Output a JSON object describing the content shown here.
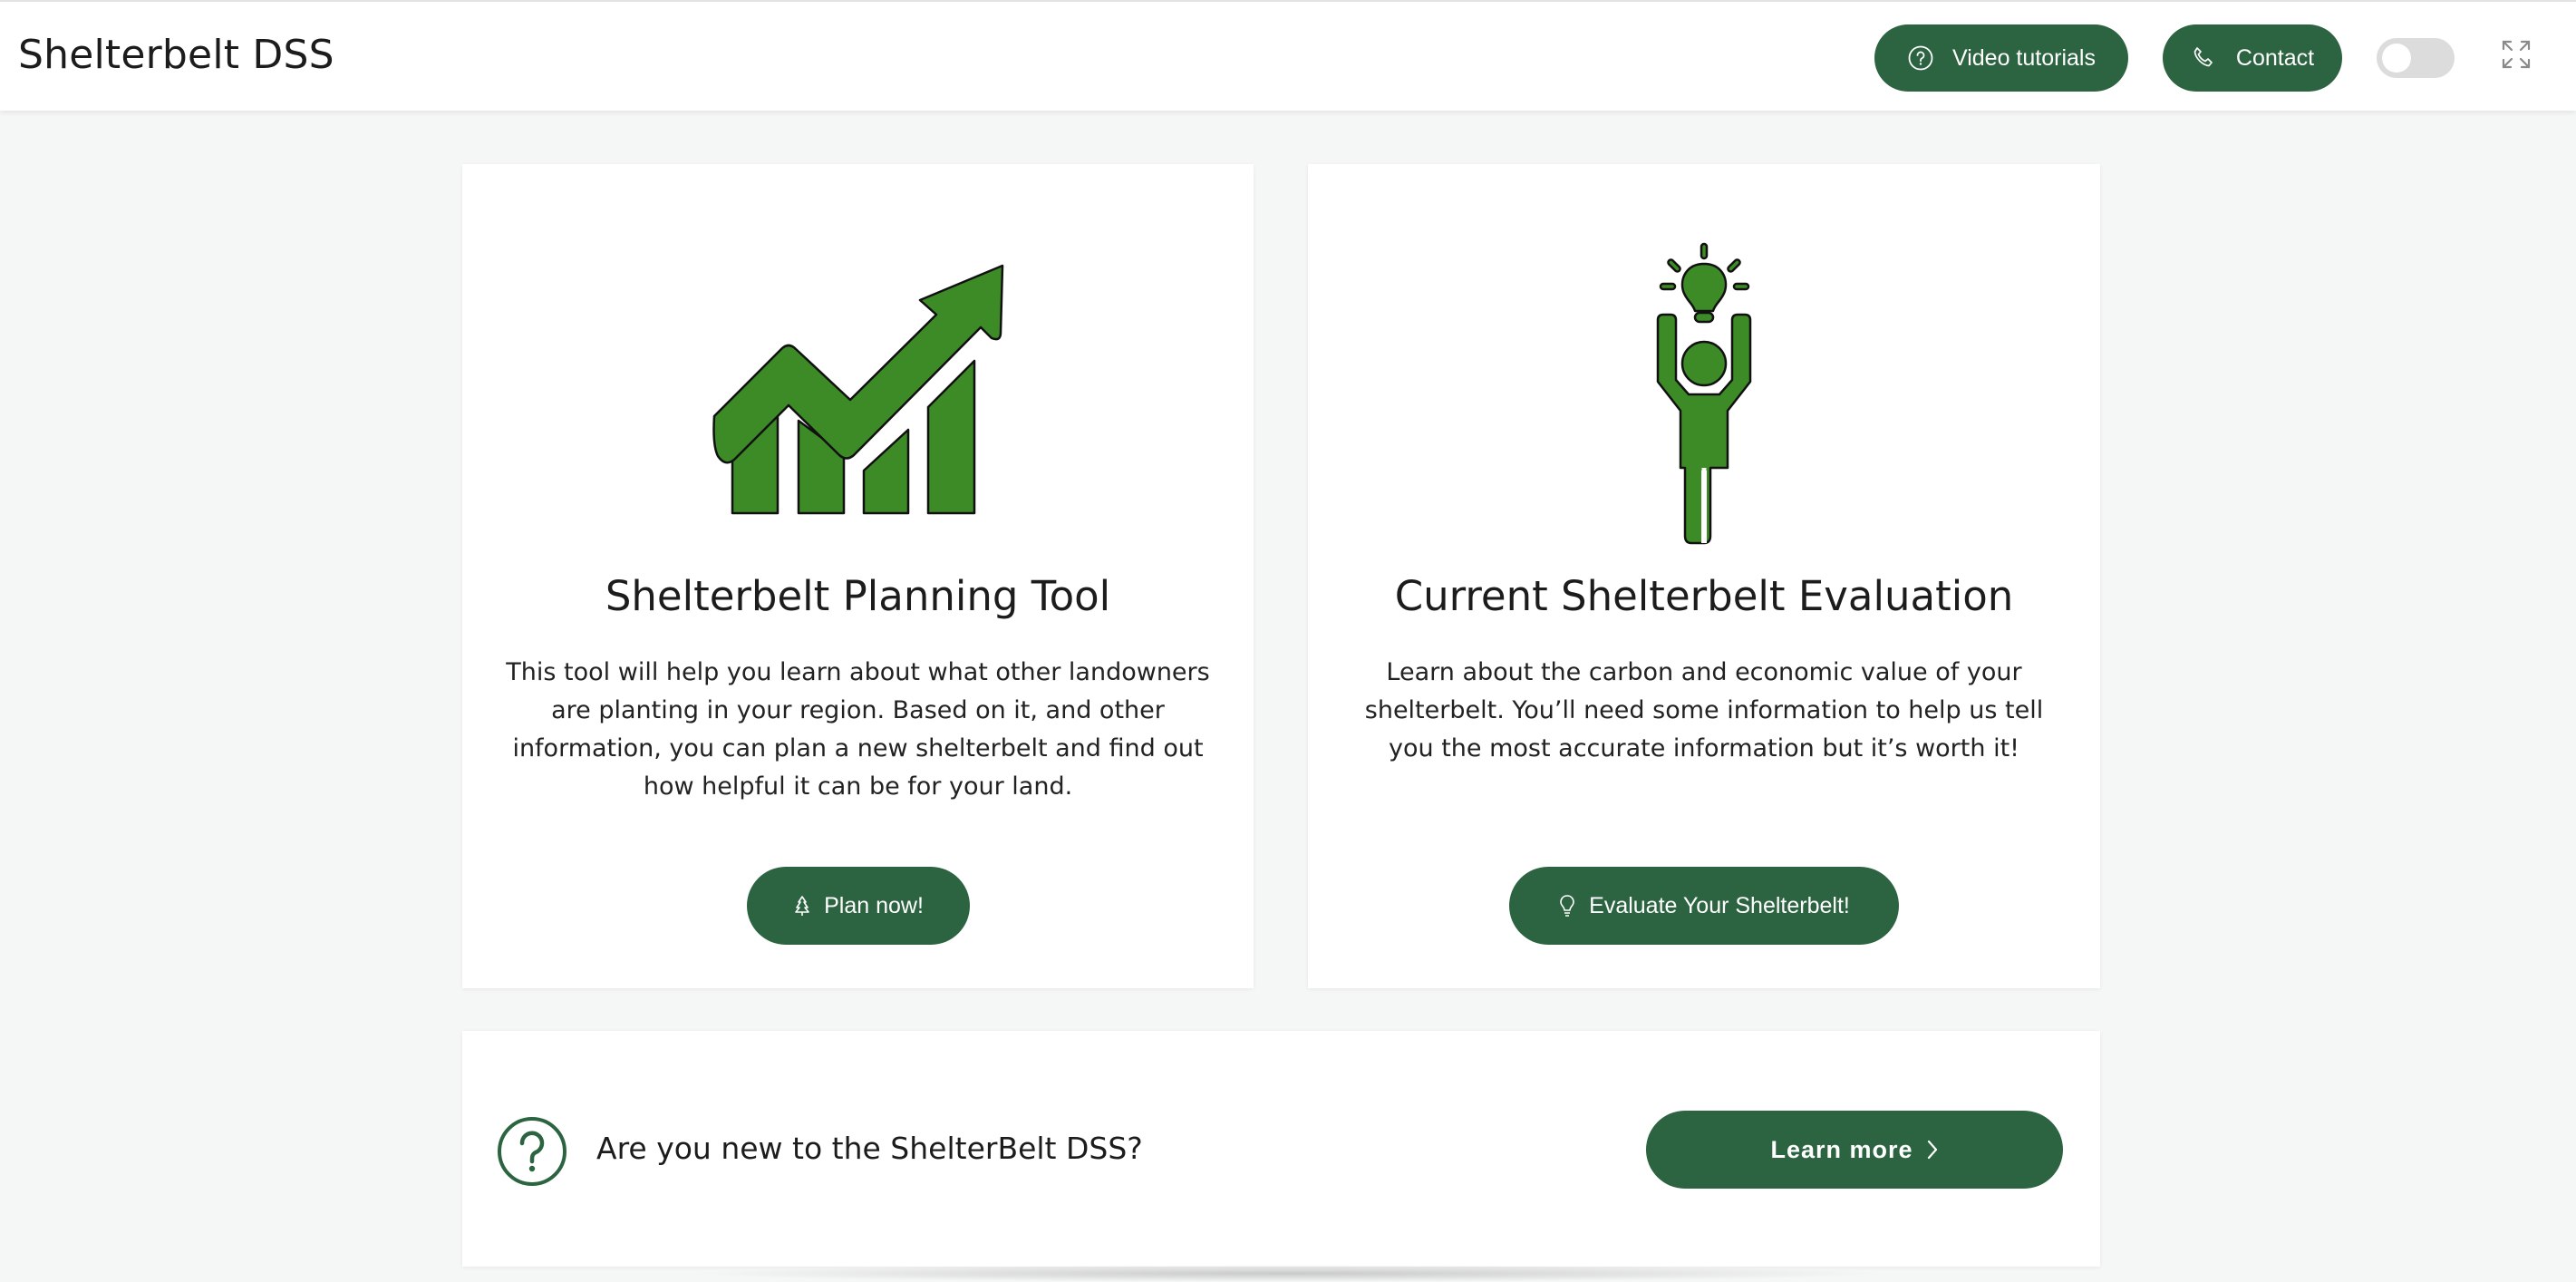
{
  "header": {
    "title": "Shelterbelt DSS",
    "video_label": "Video tutorials",
    "contact_label": "Contact",
    "toggle_state": "off"
  },
  "cards": [
    {
      "title": "Shelterbelt Planning Tool",
      "description": "This tool will help you learn about what other landowners are planting in your region. Based on it, and other information, you can plan a new shelterbelt and find out how helpful it can be for your land.",
      "button_label": "Plan now!",
      "button_icon": "tree-icon",
      "illustration": "growth-chart-icon"
    },
    {
      "title": "Current Shelterbelt Evaluation",
      "description": "Learn about the carbon and economic value of your shelterbelt. You’ll need some information to help us tell you the most accurate information but it’s worth it!",
      "button_label": "Evaluate Your Shelterbelt!",
      "button_icon": "lightbulb-icon",
      "illustration": "person-idea-icon"
    }
  ],
  "banner": {
    "question": "Are you new to the ShelterBelt DSS?",
    "button_label": "Learn more",
    "icon": "question-circle-icon"
  },
  "colors": {
    "primary": "#2c6441",
    "illustration_green": "#3d8b27",
    "background": "#f5f6f6",
    "toggle_off": "#dcdcdc"
  }
}
